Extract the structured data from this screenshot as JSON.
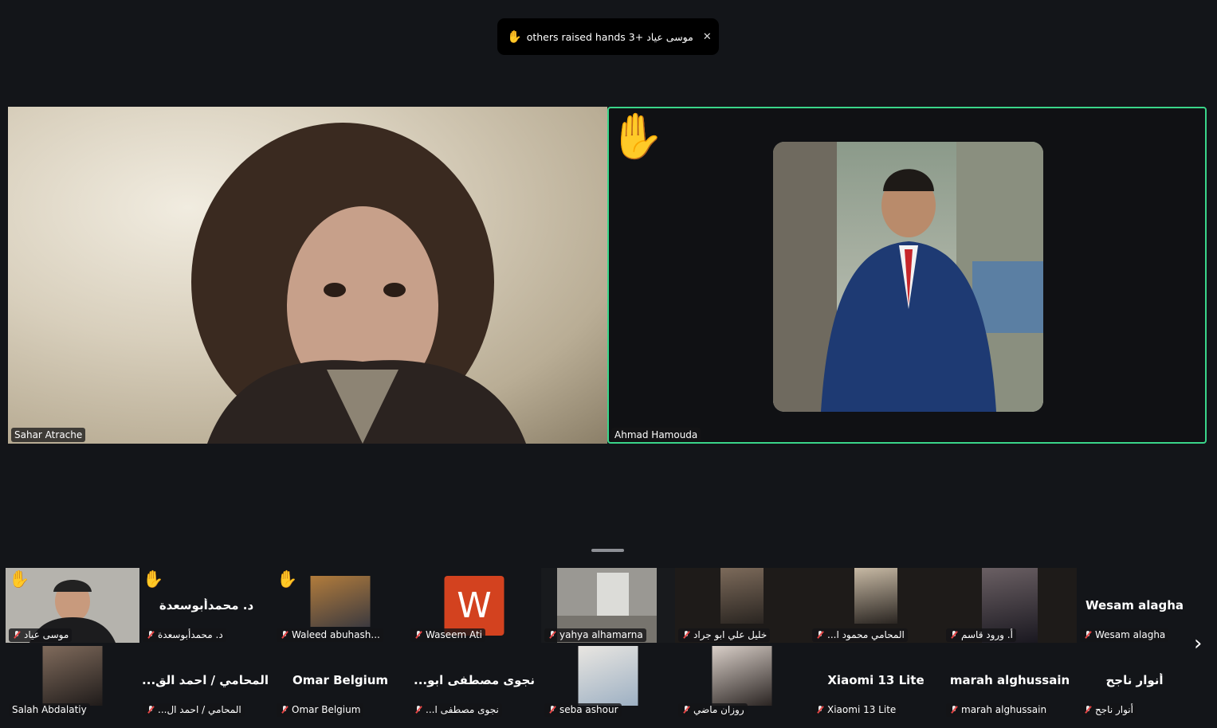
{
  "banner": {
    "hand": "✋",
    "text": "موسى عياد +3 others raised hands",
    "close": "✕"
  },
  "main": {
    "left": {
      "name": "Sahar Atrache"
    },
    "right": {
      "name": "Ahmad Hamouda",
      "hand": "✋"
    }
  },
  "thumbnails": [
    {
      "name": "موسى عياد",
      "hand": "✋",
      "kind": "video"
    },
    {
      "name": "د. محمدأبوسعدة",
      "center": "د. محمدأبوسعدة",
      "hand": "✋",
      "kind": "name"
    },
    {
      "name": "Waleed abuhash...",
      "hand": "✋",
      "kind": "photo"
    },
    {
      "name": "Waseem Ati",
      "letter": "W",
      "kind": "letter"
    },
    {
      "name": "yahya alhamarna",
      "kind": "video"
    },
    {
      "name": "خليل علي ابو جراد",
      "kind": "photo"
    },
    {
      "name": "المحامي محمود ا...",
      "kind": "photo"
    },
    {
      "name": "أ. ورود قاسم",
      "kind": "photo"
    },
    {
      "name": "Salah Abdalatiy",
      "kind": "photo"
    },
    {
      "name": "المحامي / احمد ال...",
      "center": "المحامي / احمد الق...",
      "kind": "name"
    },
    {
      "name": "Omar Belgium",
      "center": "Omar Belgium",
      "kind": "name"
    },
    {
      "name": "نجوى مصطفى ا...",
      "center": "نجوى مصطفى ابو...",
      "kind": "name"
    },
    {
      "name": "seba ashour",
      "kind": "photo"
    },
    {
      "name": "روزان ماضي",
      "kind": "photo"
    },
    {
      "name": "Xiaomi 13 Lite",
      "center": "Xiaomi 13 Lite",
      "kind": "name"
    },
    {
      "name": "marah alghussain",
      "center": "marah alghussain",
      "kind": "name"
    }
  ],
  "extra_column": [
    {
      "name": "Wesam alagha",
      "center": "Wesam alagha"
    },
    {
      "name": "أنوار ناجح",
      "center": "أنوار ناجح"
    }
  ],
  "nav": {
    "next": "›"
  }
}
